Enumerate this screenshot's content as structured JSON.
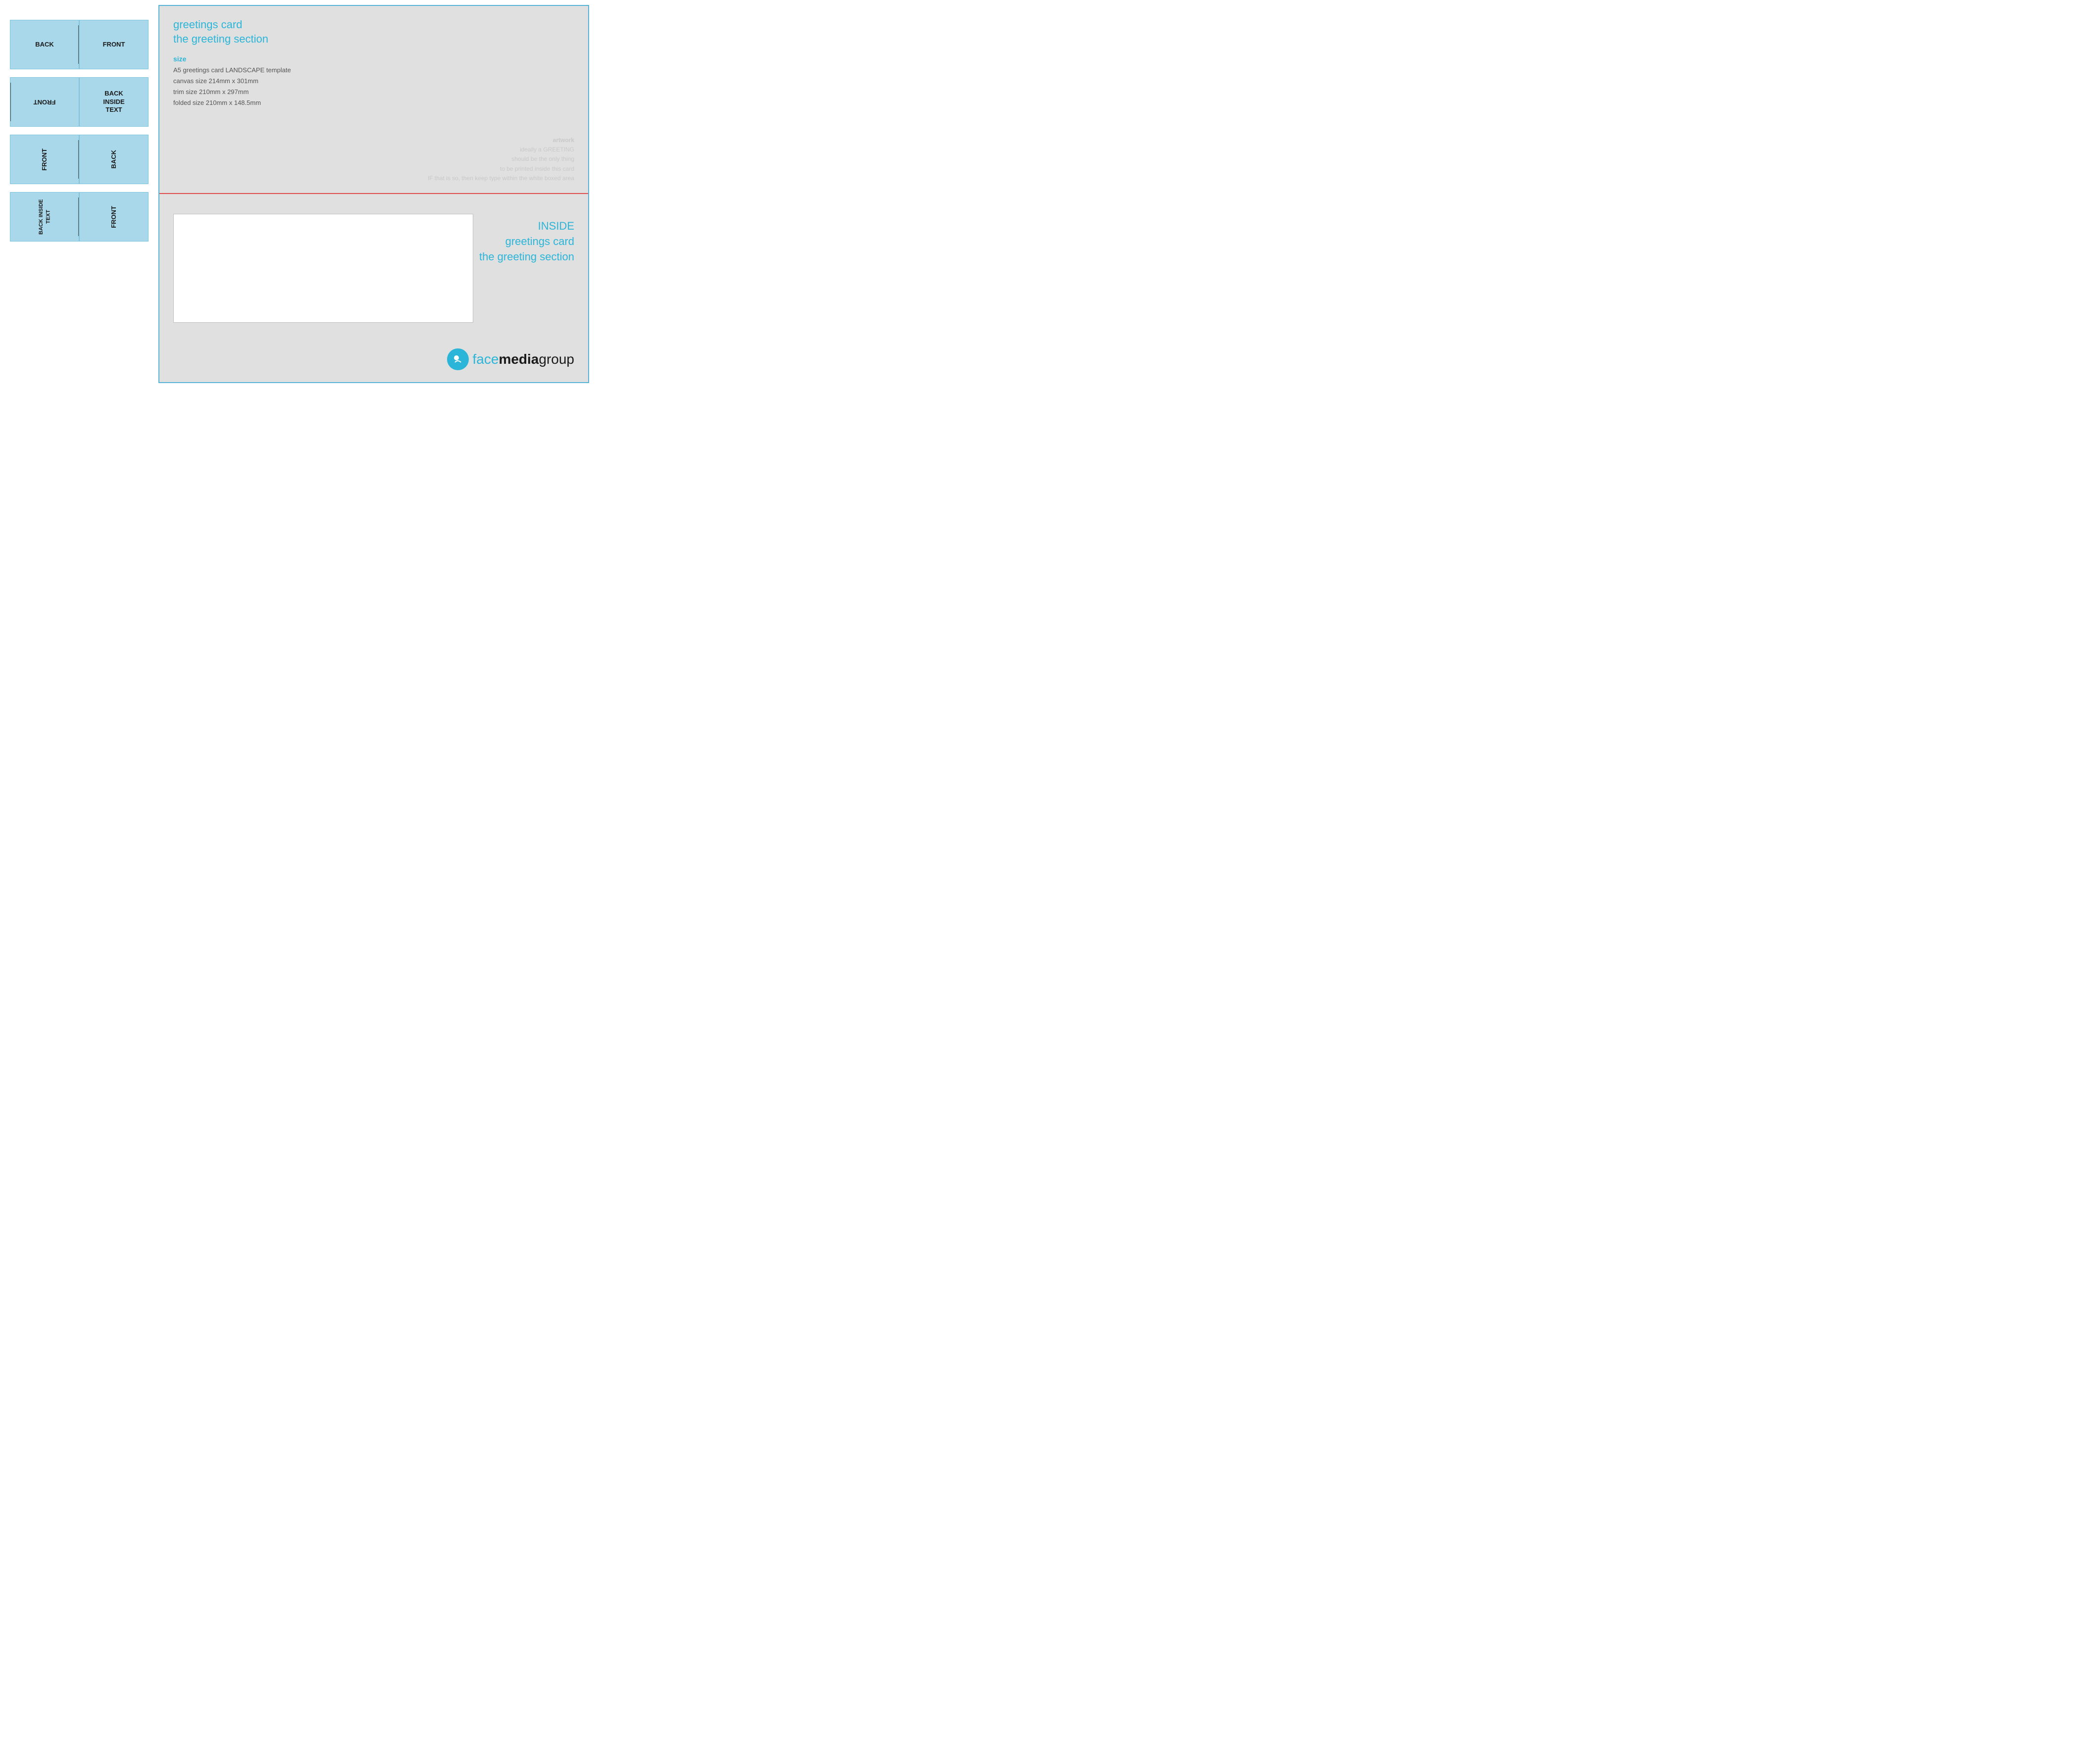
{
  "left": {
    "row1": {
      "left_label": "BACK",
      "right_label": "FRONT"
    },
    "row2": {
      "left_label": "FRONT",
      "right_label_line1": "BACK",
      "right_label_line2": "INSIDE",
      "right_label_line3": "TEXT"
    },
    "row3": {
      "left_label": "FRONT",
      "right_label": "BACK"
    },
    "row4": {
      "left_label_line1": "BACK",
      "left_label_line2": "INSIDE",
      "left_label_line3": "TEXT",
      "right_label": "FRONT"
    }
  },
  "right": {
    "top": {
      "title_line1": "greetings card",
      "title_line2": "the greeting section",
      "size_label": "size",
      "size_line1": "A5 greetings card LANDSCAPE template",
      "size_line2": "canvas size 214mm x 301mm",
      "size_line3": "trim size 210mm x 297mm",
      "size_line4": "folded size 210mm x 148.5mm",
      "artwork_label": "artwork",
      "artwork_line1": "ideally a GREETING",
      "artwork_line2": "should be the only thing",
      "artwork_line3": "to be printed inside this card",
      "artwork_line4": "IF that is so, then keep type within the white boxed area"
    },
    "bottom": {
      "inside_line1": "INSIDE",
      "inside_line2": "greetings card",
      "inside_line3": "the greeting section"
    },
    "brand": {
      "icon_text": ")",
      "face": "face",
      "media": "media",
      "group": "group"
    }
  }
}
